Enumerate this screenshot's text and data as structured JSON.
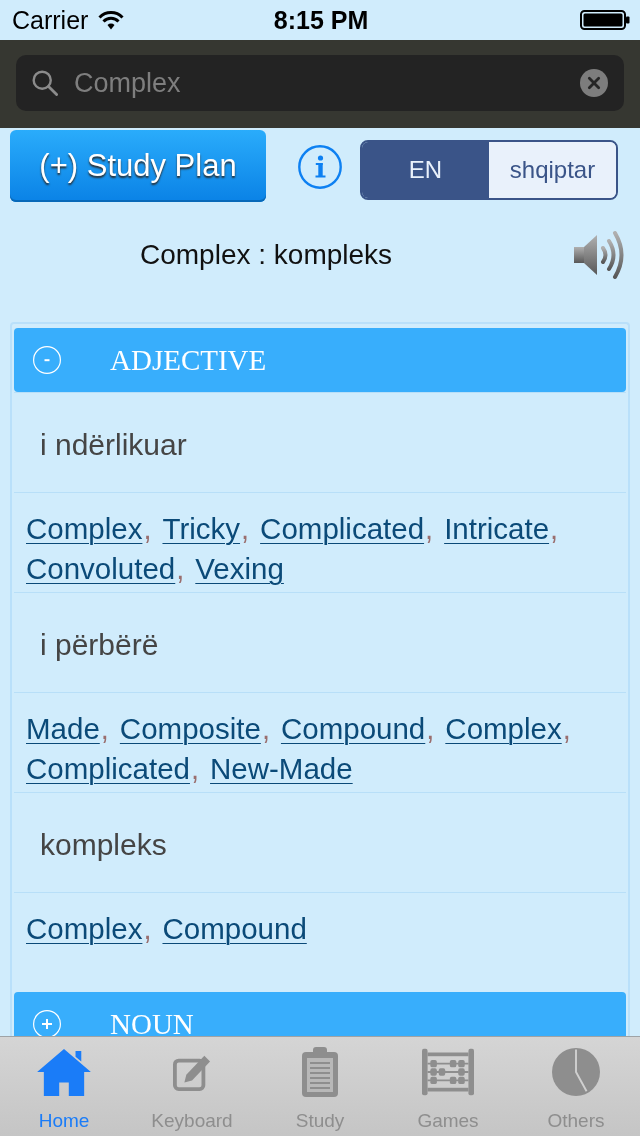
{
  "status_bar": {
    "carrier": "Carrier",
    "time": "8:15 PM"
  },
  "search": {
    "value": "Complex"
  },
  "study_plan_button": "(+) Study Plan",
  "language_toggle": [
    {
      "label": "EN",
      "selected": true
    },
    {
      "label": "shqiptar",
      "selected": false
    }
  ],
  "headword": "Complex : kompleks",
  "sections": [
    {
      "title": "ADJECTIVE",
      "expanded": true,
      "senses": [
        {
          "translation": "i ndërlikuar",
          "synonyms": [
            {
              "text": "Complex",
              "separator": ","
            },
            {
              "text": "Tricky",
              "separator": ","
            },
            {
              "text": "Complicated",
              "separator": ","
            },
            {
              "text": "Intricate",
              "separator": ","
            },
            {
              "text": "Convoluted",
              "separator": ","
            },
            {
              "text": "Vexing"
            }
          ]
        },
        {
          "translation": "i përbërë",
          "synonyms": [
            {
              "text": "Made",
              "separator": ","
            },
            {
              "text": "Composite",
              "separator": ","
            },
            {
              "text": "Compound",
              "separator": ","
            },
            {
              "text": "Complex",
              "separator": ","
            },
            {
              "text": "Complicated",
              "separator": ","
            },
            {
              "text": "New-Made"
            }
          ]
        },
        {
          "translation": "kompleks",
          "synonyms": [
            {
              "text": "Complex",
              "separator": ","
            },
            {
              "text": "Compound"
            }
          ]
        }
      ]
    },
    {
      "title": "NOUN",
      "expanded": false
    }
  ],
  "tabs": [
    {
      "kind": "home",
      "label": "Home",
      "selected": true
    },
    {
      "kind": "keyboard",
      "label": "Keyboard",
      "selected": false
    },
    {
      "kind": "study",
      "label": "Study",
      "selected": false
    },
    {
      "kind": "games",
      "label": "Games",
      "selected": false
    },
    {
      "kind": "others",
      "label": "Others",
      "selected": false
    }
  ]
}
